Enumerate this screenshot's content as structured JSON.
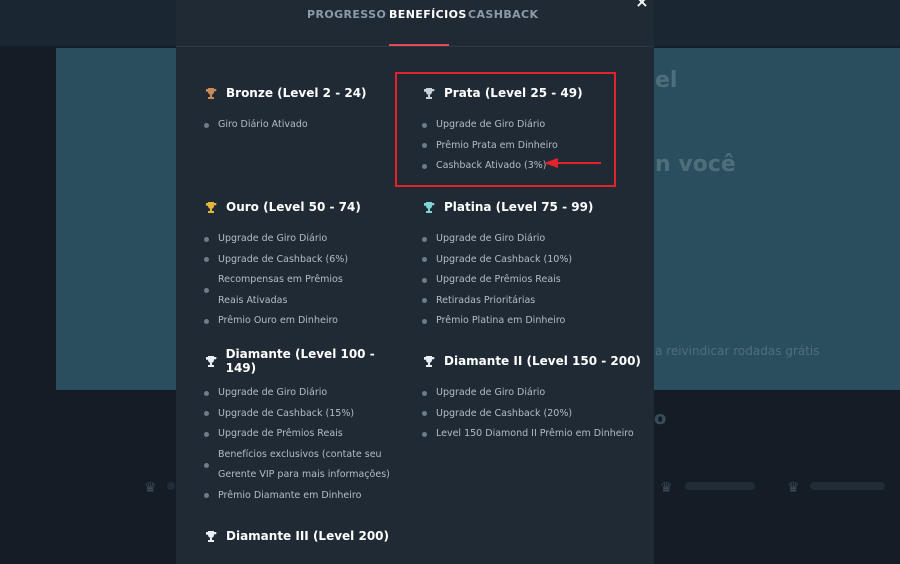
{
  "background": {
    "heading_1": "el",
    "heading_2": "n você",
    "subtext": "a reivindicar rodadas grátis",
    "heading_3": "o"
  },
  "modal": {
    "close_label": "×",
    "tabs": [
      {
        "label": "PROGRESSO",
        "active": false
      },
      {
        "label": "BENEFÍCIOS",
        "active": true
      },
      {
        "label": "CASHBACK",
        "active": false
      }
    ],
    "levels": [
      {
        "title": "Bronze (Level 2 - 24)",
        "icon": "trophy-bronze-icon",
        "color": "#c98a5a",
        "benefits": [
          "Giro Diário Ativado"
        ]
      },
      {
        "title": "Prata (Level 25 - 49)",
        "icon": "trophy-silver-icon",
        "color": "#c8d0d8",
        "benefits": [
          "Upgrade de Giro Diário",
          "Prêmio Prata em Dinheiro",
          "Cashback Ativado (3%)"
        ]
      },
      {
        "title": "Ouro (Level 50 - 74)",
        "icon": "trophy-gold-icon",
        "color": "#e4b53d",
        "benefits": [
          "Upgrade de Giro Diário",
          "Upgrade de Cashback (6%)",
          "Recompensas em Prêmios Reais Ativadas",
          "Prêmio Ouro em Dinheiro"
        ]
      },
      {
        "title": "Platina (Level 75 - 99)",
        "icon": "trophy-platinum-icon",
        "color": "#7fd4d6",
        "benefits": [
          "Upgrade de Giro Diário",
          "Upgrade de Cashback (10%)",
          "Upgrade de Prêmios Reais",
          "Retiradas Prioritárias",
          "Prêmio Platina em Dinheiro"
        ]
      },
      {
        "title": "Diamante (Level 100 - 149)",
        "icon": "trophy-diamond-icon",
        "color": "#e8eef4",
        "benefits": [
          "Upgrade de Giro Diário",
          "Upgrade de Cashback (15%)",
          "Upgrade de Prêmios Reais",
          "Benefícios exclusivos (contate seu Gerente VIP para mais informações)",
          "Prêmio Diamante em Dinheiro"
        ]
      },
      {
        "title": "Diamante II (Level 150 - 200)",
        "icon": "trophy-diamond-icon",
        "color": "#e8eef4",
        "benefits": [
          "Upgrade de Giro Diário",
          "Upgrade de Cashback (20%)",
          "Level 150 Diamond II Prêmio em Dinheiro"
        ]
      },
      {
        "title": "Diamante III (Level 200)",
        "icon": "trophy-diamond-icon",
        "color": "#e8eef4",
        "benefits": []
      }
    ]
  },
  "annotation": {
    "color": "#e2232b"
  }
}
